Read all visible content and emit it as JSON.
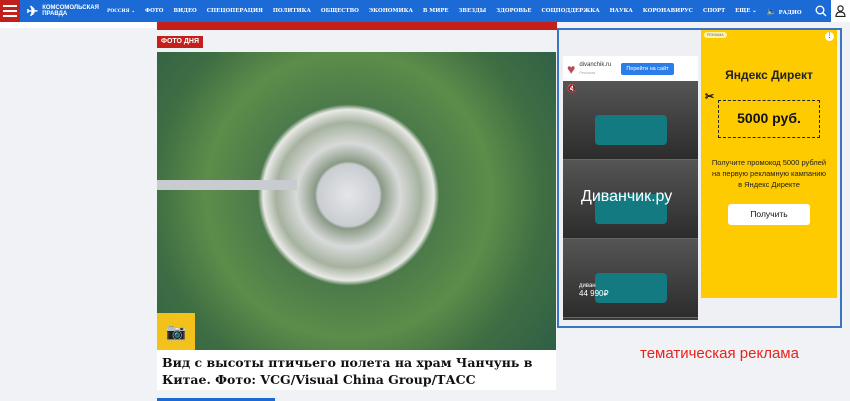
{
  "header": {
    "logo_text": "Комсомольская правда",
    "region": "РОССИЯ",
    "nav": [
      "ФОТО",
      "ВИДЕО",
      "СПЕЦОПЕРАЦИЯ",
      "ПОЛИТИКА",
      "ОБЩЕСТВО",
      "ЭКОНОМИКА",
      "В МИРЕ",
      "ЗВЕЗДЫ",
      "ЗДОРОВЬЕ",
      "СОЦПОДДЕРЖКА",
      "НАУКА",
      "КОРОНАВИРУС",
      "СПОРТ"
    ],
    "more": "ЕЩЕ",
    "radio": "РАДИО"
  },
  "article": {
    "badge": "ФОТО ДНЯ",
    "caption": "Вид с высоты птичьего полета на храм Чанчунь в Китае. Фото: VCG/Visual China Group/ТАСС"
  },
  "ads": {
    "divan": {
      "domain": "divanchik.ru",
      "label": "Реклама",
      "cta": "Перейти на сайт",
      "brand": "Диванчик.ру",
      "price_label": "диван",
      "price": "44 990₽"
    },
    "yandex": {
      "label": "РЕКЛАМА",
      "logo": "Яндекс Директ",
      "amount": "5000 руб.",
      "promo": "Получите промокод 5000 рублей на первую рекламную кампанию в Яндекс Директе",
      "cta": "Получить"
    }
  },
  "annotation": "тематическая реклама",
  "colors": {
    "brand_blue": "#1b6ad6",
    "brand_red": "#c4201b",
    "yandex_yellow": "#fdcb00",
    "annotation_red": "#e5241e"
  }
}
